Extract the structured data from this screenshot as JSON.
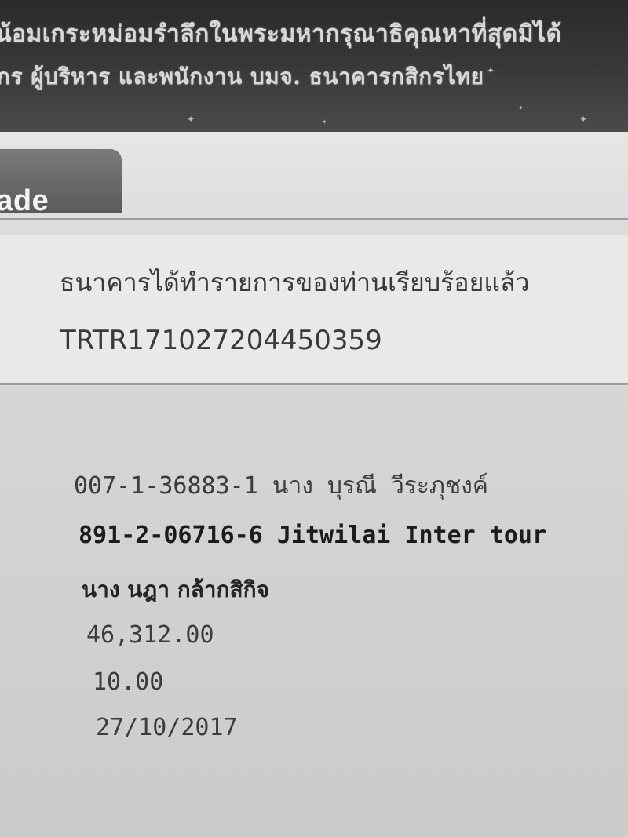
{
  "banner": {
    "line1": "น้อมเกระหม่อมรำลึกในพระมหากรุณาธิคุณหาที่สุดมิได้",
    "line2": "กร ผู้บริหาร และพนักงาน บมจ. ธนาคารกสิกรไทย"
  },
  "tab": {
    "label": "rade"
  },
  "result": {
    "status": "ธนาคารได้ทำรายการของท่านเรียบร้อยแล้ว",
    "reference": "TRTR171027204450359"
  },
  "transfer": {
    "from_account": "007-1-36883-1 นาง บุรณี วีระภุชงค์",
    "to_account": "891-2-06716-6 Jitwilai Inter tour",
    "to_name": "นาง นฎา กล้ากสิกิจ",
    "amount": "46,312.00",
    "fee": "10.00",
    "date": "27/10/2017"
  }
}
